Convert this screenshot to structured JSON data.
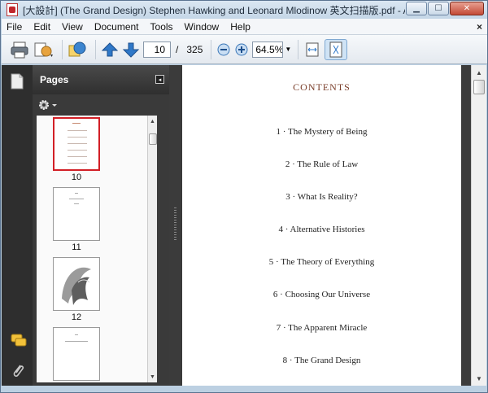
{
  "window": {
    "title": "[大設計] (The Grand Design) Stephen Hawking and Leonard Mlodinow 英文扫描版.pdf - Adobe Reader",
    "controls": [
      "minimize",
      "maximize",
      "close"
    ]
  },
  "menubar": {
    "items": [
      "File",
      "Edit",
      "View",
      "Document",
      "Tools",
      "Window",
      "Help"
    ],
    "close_glyph": "×"
  },
  "toolbar": {
    "current_page": "10",
    "page_separator": "/",
    "total_pages": "325",
    "zoom": "64.5%",
    "colors": {
      "arrow": "#2f78c8",
      "accent": "#4a8fd8"
    }
  },
  "panel": {
    "title": "Pages",
    "thumbnails": [
      {
        "label": "10",
        "selected": true
      },
      {
        "label": "11",
        "selected": false
      },
      {
        "label": "12",
        "selected": false
      },
      {
        "label": "",
        "selected": false
      }
    ]
  },
  "document": {
    "heading": "CONTENTS",
    "entries": [
      "1 · The Mystery of Being",
      "2 · The Rule of Law",
      "3 · What Is Reality?",
      "4 · Alternative Histories",
      "5 · The Theory of Everything",
      "6 · Choosing Our Universe",
      "7 · The Apparent Miracle",
      "8 · The Grand Design"
    ],
    "heading_color": "#7a3e2a"
  }
}
